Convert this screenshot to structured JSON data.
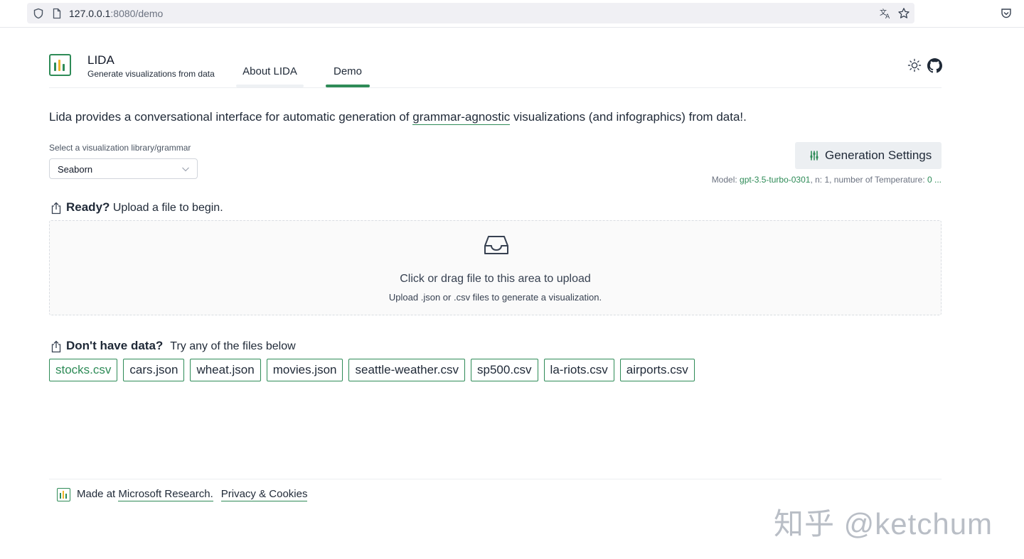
{
  "browser": {
    "url_host": "127.0.0.1",
    "url_path": ":8080/demo"
  },
  "header": {
    "title": "LIDA",
    "subtitle": "Generate visualizations from data",
    "tabs": [
      {
        "label": "About LIDA",
        "active": false
      },
      {
        "label": "Demo",
        "active": true
      }
    ]
  },
  "intro": {
    "before": "Lida provides a conversational interface for automatic generation of ",
    "link": "grammar-agnostic",
    "after": " visualizations (and infographics) from data!."
  },
  "library_select": {
    "label": "Select a visualization library/grammar",
    "value": "Seaborn"
  },
  "generation": {
    "button_label": "Generation Settings",
    "model_prefix": "Model: ",
    "model": "gpt-3.5-turbo-0301",
    "n_text": ", n: 1, number of Temperature: ",
    "temperature": "0 ..."
  },
  "upload": {
    "ready_strong": "Ready?",
    "ready_text": " Upload a file to begin.",
    "drop_title": "Click or drag file to this area to upload",
    "drop_hint": "Upload .json or .csv files to generate a visualization."
  },
  "samples": {
    "heading_strong": "Don't have data?",
    "heading_text": "Try any of the files below",
    "files": [
      "stocks.csv",
      "cars.json",
      "wheat.json",
      "movies.json",
      "seattle-weather.csv",
      "sp500.csv",
      "la-riots.csv",
      "airports.csv"
    ]
  },
  "footer": {
    "made_at": "Made at ",
    "research_link": "Microsoft Research.",
    "privacy_link": "Privacy & Cookies"
  },
  "watermark": "知乎 @ketchum",
  "colors": {
    "accent": "#2e8b57",
    "chip_border": "#2e8b57",
    "button_bg": "#eceff2"
  },
  "icons": {
    "shield": "shield-icon",
    "page": "page-icon",
    "translate": "translate-icon",
    "star": "star-icon",
    "pocket": "pocket-icon",
    "logo": "bar-chart-logo-icon",
    "theme": "sun-icon",
    "github": "github-icon",
    "chevron": "chevron-down-icon",
    "sliders": "sliders-icon",
    "upload": "upload-icon",
    "inbox": "inbox-icon"
  }
}
